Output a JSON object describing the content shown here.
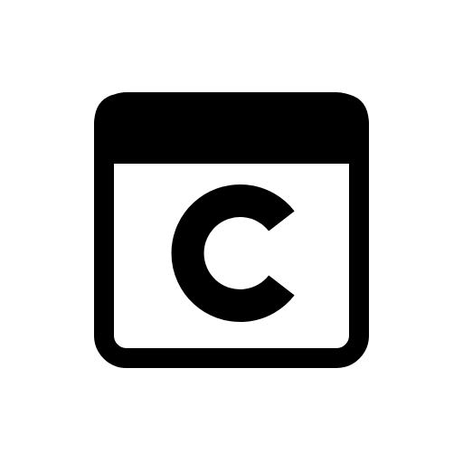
{
  "icon": {
    "name": "browser-window-c-icon",
    "letter": "C",
    "colors": {
      "foreground": "#000000",
      "background": "#ffffff"
    }
  }
}
